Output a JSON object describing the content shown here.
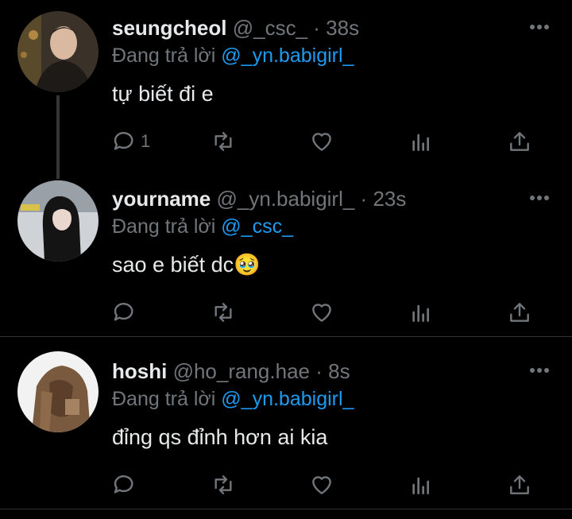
{
  "tweets": [
    {
      "name": "seungcheol",
      "handle": "@_csc_",
      "time": "38s",
      "replying_prefix": "Đang trả lời",
      "replying_to": "@_yn.babigirl_",
      "text": "tự biết đi e",
      "reply_count": "1"
    },
    {
      "name": "yourname",
      "handle": "@_yn.babigirl_",
      "time": "23s",
      "replying_prefix": "Đang trả lời",
      "replying_to": "@_csc_",
      "text": "sao e biết dc🥹",
      "reply_count": ""
    },
    {
      "name": "hoshi",
      "handle": "@ho_rang.hae",
      "time": "8s",
      "replying_prefix": "Đang trả lời",
      "replying_to": "@_yn.babigirl_",
      "text": "đỉng qs đỉnh hơn ai kia",
      "reply_count": ""
    }
  ],
  "colors": {
    "background": "#000000",
    "text": "#e7e9ea",
    "muted": "#71767b",
    "accent": "#1d9bf0",
    "thread_line": "#333639"
  },
  "icons": [
    "reply-icon",
    "retweet-icon",
    "like-icon",
    "views-icon",
    "share-icon",
    "more-icon"
  ]
}
